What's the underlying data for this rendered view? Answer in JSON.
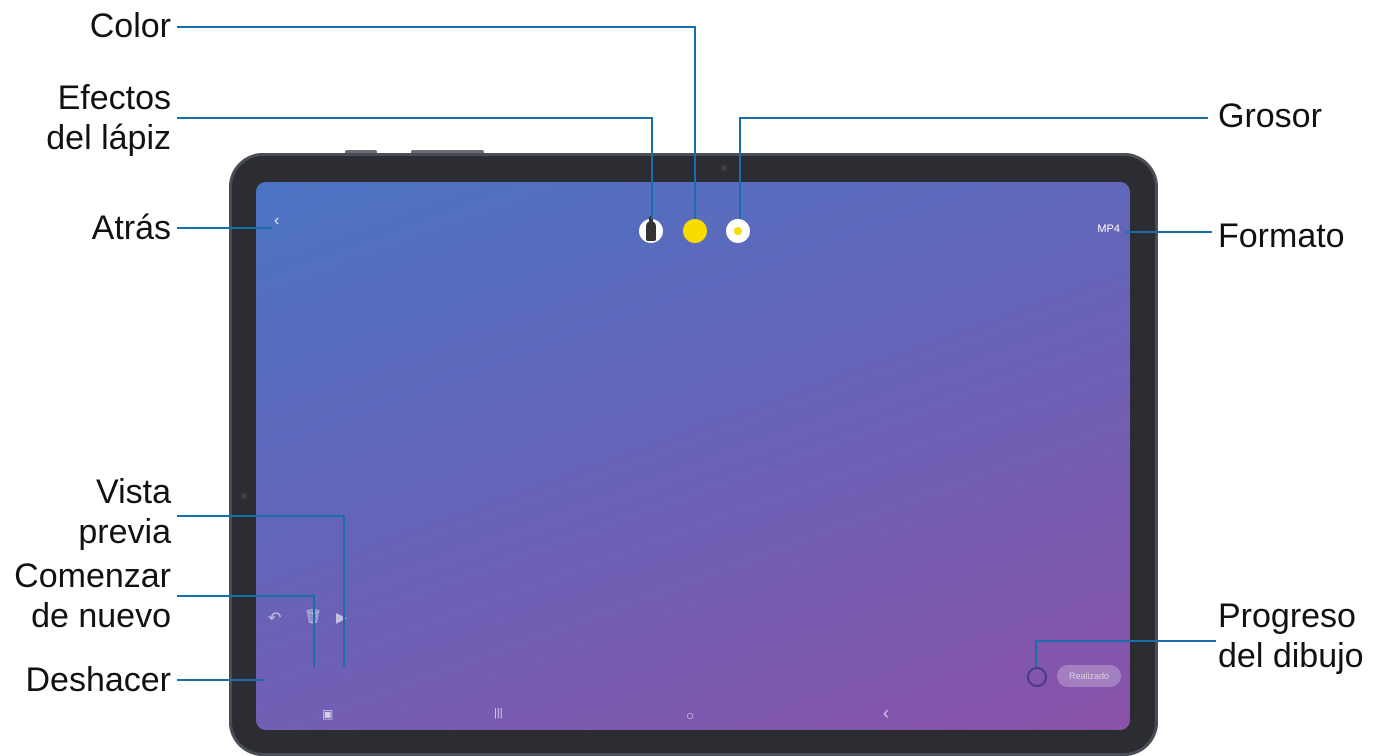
{
  "labels": {
    "color": "Color",
    "efectos": "Efectos\ndel lápiz",
    "atras": "Atrás",
    "vista": "Vista\nprevia",
    "comenzar": "Comenzar\nde nuevo",
    "deshacer": "Deshacer",
    "grosor": "Grosor",
    "formato": "Formato",
    "progreso": "Progreso\ndel dibujo"
  },
  "screen": {
    "format_value": "MP4",
    "done_label": "Realizado",
    "back_glyph": "‹",
    "nav_recent": "|||",
    "nav_home": "○",
    "nav_back": "‹"
  },
  "icons": {
    "pen_effects": "pen-effects-icon",
    "color": "color-swatch-icon",
    "thickness": "thickness-icon",
    "undo": "undo-icon",
    "trash": "trash-icon",
    "play": "play-icon"
  },
  "colors": {
    "leader": "#1a6ea8",
    "swatch": "#f7dc00"
  }
}
